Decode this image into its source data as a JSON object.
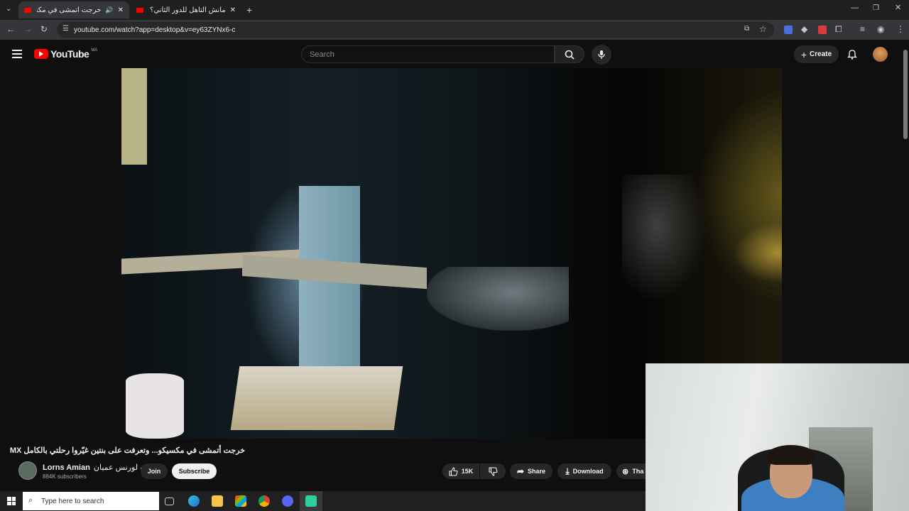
{
  "tabs": [
    {
      "title": "خرجت أتمشى في مكسيكو...",
      "active": true
    },
    {
      "title": "مانش التأهل للدور الثاني؟ (التشكيلة...",
      "active": false
    }
  ],
  "address": {
    "url": "youtube.com/watch?app=desktop&v=ey63ZYNx6-c"
  },
  "header": {
    "logo_text": "YouTube",
    "country_code": "MA",
    "search_placeholder": "Search",
    "create_label": "Create"
  },
  "video": {
    "title": "خرجت أتمشى في مكسيكو... وتعرفت على بنتين غيّروا رحلتي بالكامل MX"
  },
  "channel": {
    "name": "Lorns Amian",
    "name_ar": "لورنس عميان",
    "subscribers": "884K subscribers",
    "join_label": "Join",
    "subscribe_label": "Subscribe"
  },
  "actions": {
    "likes": "15K",
    "share_label": "Share",
    "download_label": "Download",
    "thanks_label": "Tha"
  },
  "taskbar": {
    "search_placeholder": "Type here to search"
  },
  "colors": {
    "youtube_red": "#ff0000",
    "page_bg": "#0f0f0f",
    "pill_bg": "#272727"
  }
}
